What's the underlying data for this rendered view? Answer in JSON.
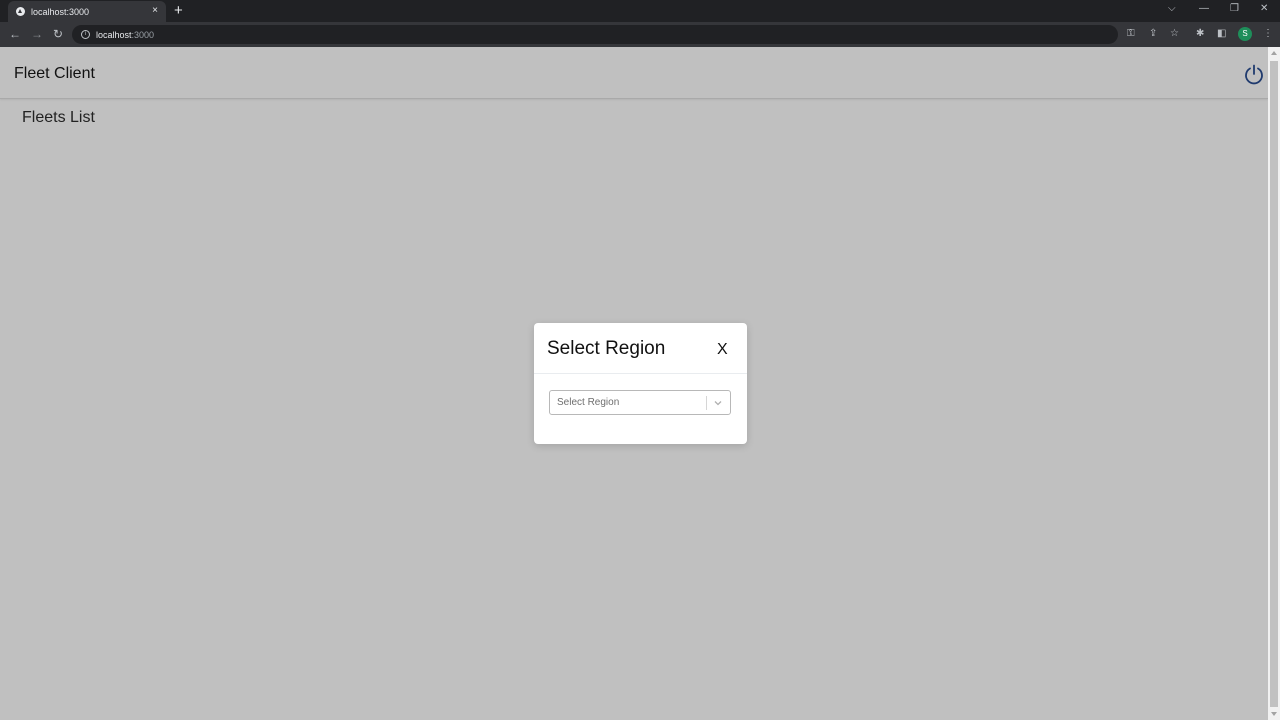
{
  "browser": {
    "tab_title": "localhost:3000",
    "tab_close": "×",
    "new_tab": "+",
    "address_host": "localhost",
    "address_port": ":3000",
    "profile_initial": "S"
  },
  "app": {
    "title": "Fleet Client",
    "section_title": "Fleets List"
  },
  "modal": {
    "title": "Select Region",
    "close_label": "X",
    "select_placeholder": "Select Region"
  }
}
